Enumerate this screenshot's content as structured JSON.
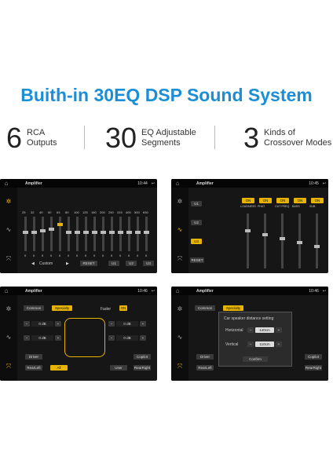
{
  "headline": "Buith-in 30EQ DSP Sound System",
  "features": [
    {
      "num": "6",
      "line1": "RCA",
      "line2": "Outputs"
    },
    {
      "num": "30",
      "line1": "EQ Adjustable",
      "line2": "Segments"
    },
    {
      "num": "3",
      "line1": "Kinds of",
      "line2": "Crossover Modes"
    }
  ],
  "app_title": "Amplifier",
  "times": [
    "10:44",
    "10:45",
    "10:46",
    "10:46"
  ],
  "eq": {
    "freqs": [
      "25",
      "32",
      "40",
      "50",
      "63",
      "80",
      "100",
      "125",
      "160",
      "200",
      "250",
      "315",
      "400",
      "500",
      "630"
    ],
    "levels": [
      0.55,
      0.55,
      0.6,
      0.65,
      0.8,
      0.55,
      0.55,
      0.55,
      0.55,
      0.55,
      0.55,
      0.55,
      0.55,
      0.55,
      0.55
    ],
    "values": [
      "0",
      "0",
      "0",
      "0",
      "0",
      "0",
      "0",
      "0",
      "0",
      "0",
      "0",
      "0",
      "0",
      "0",
      "0"
    ],
    "preset": "Custom",
    "buttons": [
      "RESET",
      "U1",
      "U2",
      "U3"
    ]
  },
  "xover": {
    "user_buttons": [
      "U1",
      "U2",
      "U3"
    ],
    "reset": "RESET",
    "columns": [
      {
        "state": "ON",
        "label": "LOUDNESS"
      },
      {
        "state": "ON",
        "label": "PHAT"
      },
      {
        "state": "ON",
        "label": "CUT FREQ"
      },
      {
        "state": "ON",
        "label": "BASS"
      },
      {
        "state": "ON",
        "label": "SUB"
      }
    ]
  },
  "sound": {
    "tabs": [
      "Common",
      "Specialty"
    ],
    "fader": "Fader",
    "on": "ON",
    "db": "0 dB",
    "seats": [
      "Driver",
      "Copilot",
      "RearLeft",
      "All",
      "User",
      "RearRight"
    ]
  },
  "dialog": {
    "title": "Car speaker distance setting",
    "horizontal_label": "Horizontal",
    "horizontal_value": "140cm",
    "vertical_label": "Vertical",
    "vertical_value": "110cm",
    "confirm": "Confirm"
  }
}
